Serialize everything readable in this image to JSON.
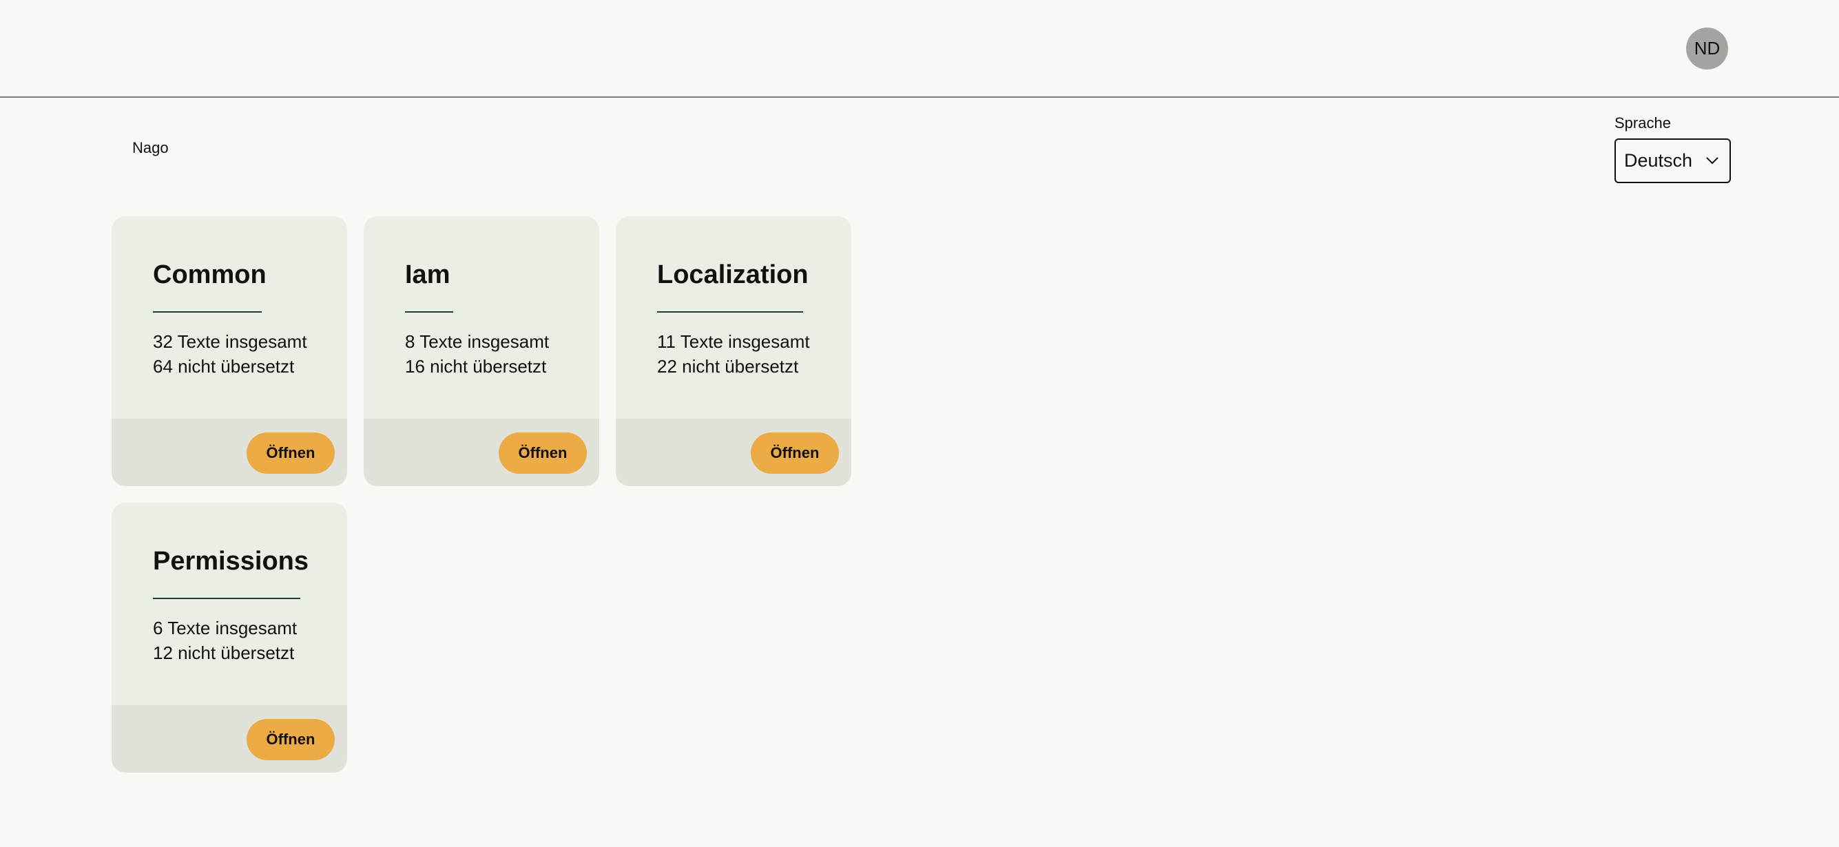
{
  "header": {
    "avatar_initials": "ND"
  },
  "breadcrumb": {
    "label": "Nago"
  },
  "language": {
    "label": "Sprache",
    "selected": "Deutsch"
  },
  "cards": [
    {
      "title": "Common",
      "total": "32 Texte insgesamt",
      "untranslated": "64 nicht übersetzt",
      "button": "Öffnen"
    },
    {
      "title": "Iam",
      "total": "8 Texte insgesamt",
      "untranslated": "16 nicht übersetzt",
      "button": "Öffnen"
    },
    {
      "title": "Localization",
      "total": "11 Texte insgesamt",
      "untranslated": "22 nicht übersetzt",
      "button": "Öffnen"
    },
    {
      "title": "Permissions",
      "total": "6 Texte insgesamt",
      "untranslated": "12 nicht übersetzt",
      "button": "Öffnen"
    }
  ],
  "colors": {
    "background": "#f8f9f4",
    "card": "#eaefe5",
    "card_footer": "#e1e3da",
    "accent": "#ecab45",
    "avatar": "#a3a6a0",
    "rule": "#1f3d33"
  }
}
